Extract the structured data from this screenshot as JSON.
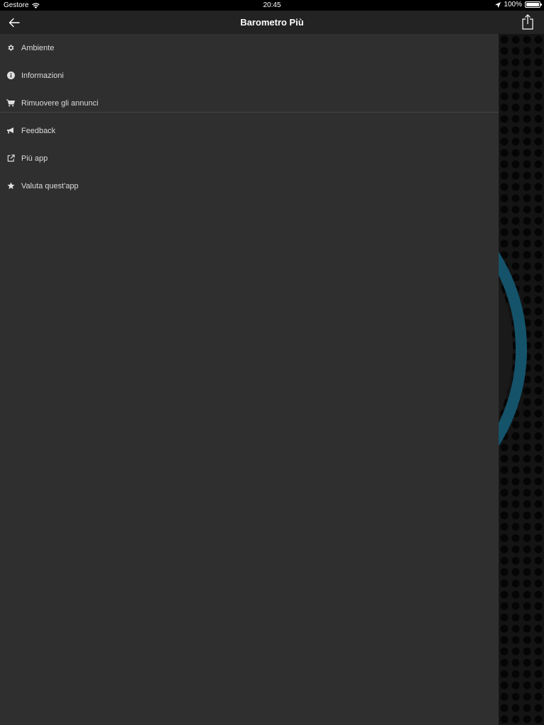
{
  "status_bar": {
    "carrier": "Gestore",
    "time": "20:45",
    "battery": "100%",
    "battery_level": 1.0
  },
  "nav": {
    "title": "Barometro Più",
    "back_icon": "arrow-left-icon",
    "share_icon": "share-icon"
  },
  "menu": {
    "items": [
      {
        "label": "Ambiente",
        "icon": "gear-icon"
      },
      {
        "label": "Informazioni",
        "icon": "info-icon"
      },
      {
        "label": "Rimuovere gli annunci",
        "icon": "cart-icon"
      },
      {
        "label": "Feedback",
        "icon": "megaphone-icon"
      },
      {
        "label": "Più app",
        "icon": "external-link-icon"
      },
      {
        "label": "Valuta quest'app",
        "icon": "star-icon"
      }
    ]
  },
  "colors": {
    "menu_bg": "#2f2f2f",
    "nav_bg": "#232323",
    "gauge_ring": "#14536a"
  }
}
